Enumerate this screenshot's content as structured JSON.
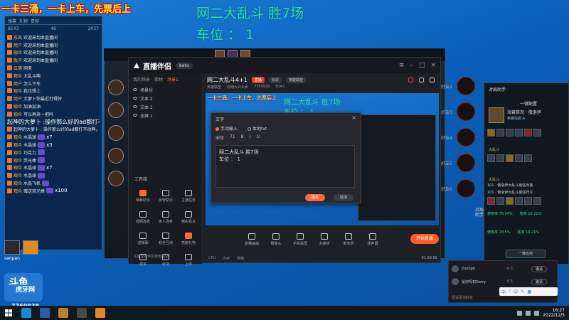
{
  "overlay": {
    "top_left": "一卡三涌，一卡上车，先票后上",
    "big_line1": "网二大乱斗 胜7场",
    "big_line2": "车位 ：  1"
  },
  "chat": {
    "tabs": [
      "弹幕",
      "礼物",
      "贵宾"
    ],
    "stats": [
      "8143",
      "48",
      "2057"
    ],
    "rows": [
      {
        "nick": "东风",
        "msg": "欢迎来到本直播间",
        "type": "small"
      },
      {
        "nick": "用户",
        "msg": "欢迎来到本直播间",
        "type": "small"
      },
      {
        "nick": "观众",
        "msg": "欢迎来到本直播间",
        "type": "small"
      },
      {
        "nick": "兔子",
        "msg": "欢迎来到本直播间",
        "type": "small"
      },
      {
        "nick": "云落",
        "msg": "刚来",
        "type": "small"
      },
      {
        "nick": "观众",
        "msg": "大乱斗啊",
        "type": "small"
      },
      {
        "nick": "用户",
        "msg": "怎么下车",
        "type": "small"
      },
      {
        "nick": "观众",
        "msg": "我也想上",
        "type": "small"
      },
      {
        "nick": "用户",
        "msg": "大萝卜你最近打得好",
        "type": "small"
      },
      {
        "nick": "观众",
        "msg": "加油加油",
        "type": "small"
      },
      {
        "nick": "观众",
        "msg": "可以再来一把吗",
        "type": "small"
      },
      {
        "nick": "",
        "msg": "起神的大萝卜 :操作那么好的ad都打不动啊，这新英雄真弱",
        "type": "big"
      },
      {
        "nick": "",
        "msg": "起神的大萝卜 : 操作那么好的ad都打不动啊，这新英雄真弱",
        "type": "small"
      },
      {
        "nick": "观众",
        "msg": "水晶球",
        "count": "x7",
        "type": "gift"
      },
      {
        "nick": "观众",
        "msg": "水晶球",
        "count": "x3",
        "type": "gift"
      },
      {
        "nick": "观众",
        "msg": "巧克力",
        "count": "",
        "type": "gift"
      },
      {
        "nick": "观众",
        "msg": "荧光棒",
        "count": "",
        "type": "gift"
      },
      {
        "nick": "观众",
        "msg": "水晶球",
        "count": "x7",
        "type": "gift"
      },
      {
        "nick": "观众",
        "msg": "水晶球",
        "count": "",
        "type": "gift"
      },
      {
        "nick": "观众",
        "msg": "水晶飞机",
        "count": "",
        "type": "gift"
      },
      {
        "nick": "观众",
        "msg": "赠送荧光棒",
        "count": "x100",
        "type": "gift"
      }
    ]
  },
  "streamer": {
    "label": "sanpan",
    "logo": "斗鱼",
    "logo_sub": "虎牙网",
    "room_id": "7769938"
  },
  "app": {
    "name": "直播伴侣",
    "version": "beta",
    "sidebar_tabs": [
      "我的场景",
      "素材",
      "场景1"
    ],
    "sources": [
      "场景分",
      "文本 2",
      "文本 1",
      "全屏 1"
    ],
    "tools_title": "工具箱",
    "tools": [
      {
        "label": "弹幕助手",
        "hot": true
      },
      {
        "label": "房管助手",
        "hot": false
      },
      {
        "label": "主播任务",
        "hot": false
      },
      {
        "label": "视频连麦",
        "hot": false
      },
      {
        "label": "多人连麦",
        "hot": false
      },
      {
        "label": "精彩看点",
        "hot": false
      },
      {
        "label": "送弹幕",
        "hot": false
      },
      {
        "label": "粉丝互动",
        "hot": false
      },
      {
        "label": "高能礼物",
        "hot": true
      },
      {
        "label": "更多",
        "hot": false
      },
      {
        "label": "玩法",
        "hot": false
      },
      {
        "label": "上传",
        "hot": false
      }
    ],
    "sidebar_foot": "斗鱼直播伴侣使用帮助",
    "room_title": "网二大乱斗4+1",
    "pill_live": "直播",
    "pill_mode": "标清",
    "pill_cat": "英雄联盟",
    "sub_info": [
      "英雄联盟",
      "云南大众大卖",
      "7769938",
      "8143"
    ],
    "dialog": {
      "title": "文字",
      "close": "×",
      "radio_a": "手动输入",
      "radio_b": "本地txt",
      "toolbar": [
        "宋体",
        "71",
        "B",
        "I",
        "U"
      ],
      "text_line1": "网二大乱斗 胜7场",
      "text_line2": "车位 ：  1",
      "ok": "确定",
      "cancel": "取消"
    },
    "bottom_tools": [
      "直播画面",
      "摄像头",
      "手机投屏",
      "多媒体",
      "麦克风",
      "扬声器"
    ],
    "start_live": "开始直播",
    "status": [
      "CPU",
      "内存",
      "网络"
    ],
    "timer": "01:59:58"
  },
  "game": {
    "circle_labels": [
      "好友2",
      "好友3",
      "好友4",
      "好友5",
      "好友6"
    ],
    "panel_title": "对局助手",
    "panel_tab": "一键配置",
    "hero_name": "海兽祭司 · 俄洛伊",
    "hero_power": "英雄强度 A",
    "tag_a": "大乱斗",
    "build_a": "101 · 俄洛伊大乱斗最强出装",
    "tag_b": "大乱斗",
    "build_b": "101 · 俄洛伊大乱斗最强符文",
    "rate_a": "使用率 76.04%",
    "rate_b": "胜率 19.21%",
    "rate_c": "使用率 18.5%",
    "rate_d": "胜率 19.21%",
    "apply_btn": "一键应用",
    "side_vert": "对局助手",
    "lobby": [
      {
        "name": "ZoeSph",
        "lvl": "6.5",
        "btn": "邀请"
      },
      {
        "name": "是你吗初Garry",
        "lvl": "6.5",
        "btn": "邀请"
      }
    ],
    "lobby_foot": "邀请添加好友"
  },
  "ime": [
    "中",
    "°",
    "☺",
    "✎",
    "▦"
  ],
  "clock": {
    "time": "16:27",
    "date": "2022/12/5"
  }
}
